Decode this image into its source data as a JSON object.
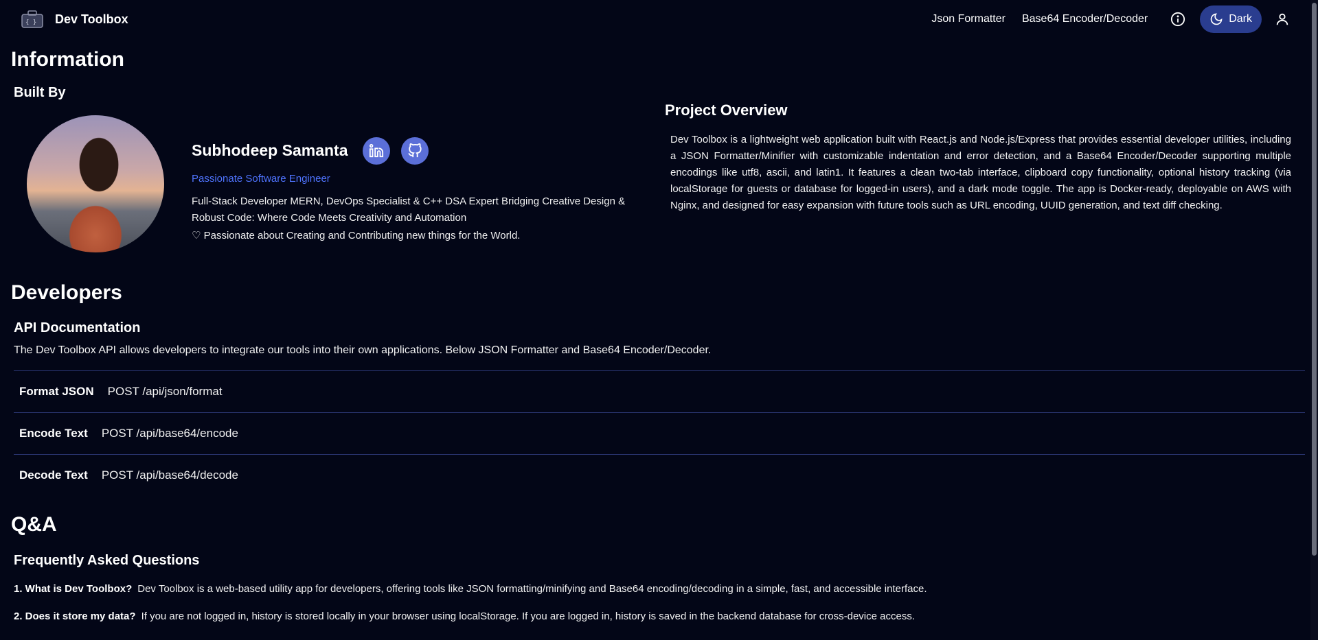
{
  "header": {
    "brand": "Dev Toolbox",
    "nav": [
      "Json Formatter",
      "Base64 Encoder/Decoder"
    ],
    "theme_label": "Dark"
  },
  "information": {
    "title": "Information",
    "built_by": "Built By",
    "name": "Subhodeep Samanta",
    "tagline": "Passionate Software Engineer",
    "bio": "Full-Stack Developer MERN, DevOps Specialist & C++ DSA Expert Bridging Creative Design & Robust Code: Where Code Meets Creativity and Automation",
    "passion": "♡ Passionate about Creating and Contributing new things for the World.",
    "overview_title": "Project Overview",
    "overview": "Dev Toolbox is a lightweight web application built with React.js and Node.js/Express that provides essential developer utilities, including a JSON Formatter/Minifier with customizable indentation and error detection, and a Base64 Encoder/Decoder supporting multiple encodings like utf8, ascii, and latin1. It features a clean two-tab interface, clipboard copy functionality, optional history tracking (via localStorage for guests or database for logged-in users), and a dark mode toggle. The app is Docker-ready, deployable on AWS with Nginx, and designed for easy expansion with future tools such as URL encoding, UUID generation, and text diff checking."
  },
  "developers": {
    "title": "Developers",
    "api_title": "API Documentation",
    "api_desc": "The Dev Toolbox API allows developers to integrate our tools into their own applications. Below JSON Formatter and Base64 Encoder/Decoder.",
    "endpoints": [
      {
        "label": "Format JSON",
        "route": "POST /api/json/format"
      },
      {
        "label": "Encode Text",
        "route": "POST /api/base64/encode"
      },
      {
        "label": "Decode Text",
        "route": "POST /api/base64/decode"
      }
    ]
  },
  "qa": {
    "title": "Q&A",
    "faq_title": "Frequently Asked Questions",
    "items": [
      {
        "q": "1. What is Dev Toolbox?",
        "a": "Dev Toolbox is a web-based utility app for developers, offering tools like JSON formatting/minifying and Base64 encoding/decoding in a simple, fast, and accessible interface."
      },
      {
        "q": "2. Does it store my data?",
        "a": "If you are not logged in, history is stored locally in your browser using localStorage. If you are logged in, history is saved in the backend database for cross-device access."
      }
    ]
  },
  "icons": {
    "logo": "toolbox-icon",
    "info": "info-icon",
    "theme": "moon-icon",
    "user": "user-icon",
    "linkedin": "linkedin-icon",
    "github": "github-icon"
  },
  "colors": {
    "background": "#030617",
    "accent": "#2a3d8f",
    "link": "#4f74ff",
    "social": "#5b6fd8",
    "divider": "#2a3571"
  }
}
